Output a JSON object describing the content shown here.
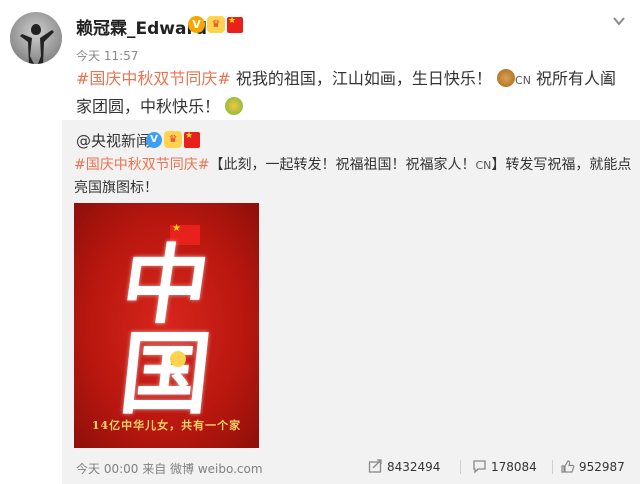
{
  "post": {
    "username": "赖冠霖_Edward",
    "badge_v": "V",
    "time": "今天 11:57",
    "hashtag": "#国庆中秋双节同庆#",
    "text_1": " 祝我的祖国，江山如画，生日快乐！",
    "cn_tag": "CN",
    "text_2": " 祝所有人阖家团圆，中秋快乐！"
  },
  "repost": {
    "username": "@央视新闻",
    "badge_v": "V",
    "hashtag": "#国庆中秋双节同庆#",
    "text_1": "【此刻，一起转发！祝福祖国！祝福家人！",
    "cn_tag": "CN",
    "text_2": "】转发写祝福，就能点亮国旗图标！",
    "poster": {
      "char_1": "中",
      "char_2": "国",
      "caption": "14亿中华儿女，共有一个家"
    }
  },
  "footer": {
    "time_source": "今天 00:00 来自 微博 weibo.com",
    "reposts": "8432494",
    "comments": "178084",
    "likes": "952987"
  },
  "colors": {
    "hashtag": "#eb7350",
    "repost_bg": "#f2f2f2",
    "poster_red": "#c81e14"
  },
  "icons": [
    "chevron-down-icon",
    "mooncake-icon",
    "beer-icon",
    "repost-icon",
    "comment-icon",
    "like-icon"
  ]
}
